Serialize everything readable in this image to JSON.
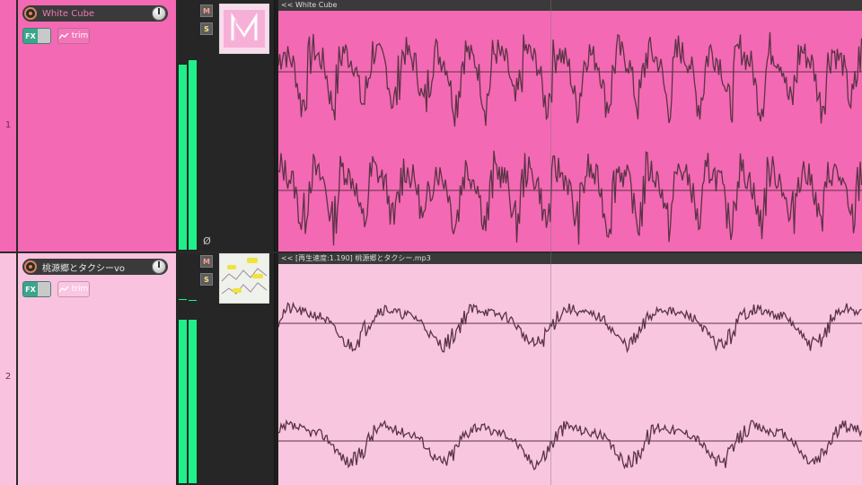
{
  "tracks": [
    {
      "number": "1",
      "name": "White Cube",
      "fx_label": "FX",
      "trim_label": "trim",
      "mute_label": "M",
      "solo_label": "S",
      "phase_symbol": "Ø",
      "item_title": "<< White Cube",
      "color": "#f469b3"
    },
    {
      "number": "2",
      "name": "桃源郷とタクシーvo",
      "fx_label": "FX",
      "trim_label": "trim",
      "mute_label": "M",
      "solo_label": "S",
      "item_title": "<< [再生速度:1.190] 桃源郷とタクシー.mp3",
      "color": "#f9c3df"
    }
  ],
  "icons": {
    "record": "record-arm-icon",
    "volume": "volume-knob-icon",
    "envelope": "envelope-icon",
    "phase": "phase-invert-icon"
  },
  "colors": {
    "meter": "#1ff08a",
    "wave_line": "#5a3346",
    "fx_on": "#3aa58c"
  }
}
